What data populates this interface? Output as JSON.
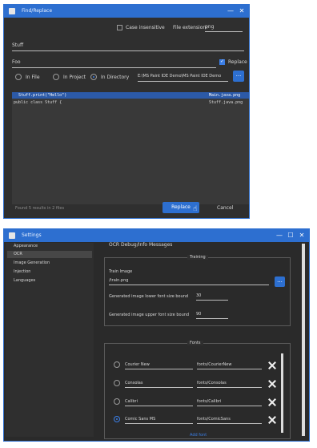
{
  "find_replace": {
    "title": "Find/Replace",
    "case_insensitive": "Case insensitive",
    "file_extension_label": "File extension:",
    "file_extension_value": "png",
    "find_value": "Stuff",
    "replace_value": "Foo",
    "replace_checkbox": "Replace",
    "scope_in_file": "In File",
    "scope_in_project": "In Project",
    "scope_in_directory": "In Directory",
    "directory_path": "E:\\MS Paint IDE Demo\\MS Paint IDE Demo",
    "browse_button": "...",
    "results": [
      {
        "code": "Stuff.print(\"Hello\")",
        "file": "Main.java.png",
        "selected": true
      },
      {
        "code": "public class Stuff {",
        "file": "Stuff.java.png",
        "selected": false
      }
    ],
    "status": "Found 5 results in 2 files",
    "replace_button": "Replace",
    "cancel_button": "Cancel"
  },
  "settings": {
    "title": "Settings",
    "sidebar": [
      "Appearance",
      "OCR",
      "Image Generation",
      "Injection",
      "Languages"
    ],
    "ocr_debug": "OCR Debug/Info Messages",
    "training_group": "Training",
    "train_image_label": "Train Image",
    "train_image_value": "/train.png",
    "lower_bound_label": "Generated image lower font size bound",
    "lower_bound_value": "30",
    "upper_bound_label": "Generated image upper font size bound",
    "upper_bound_value": "90",
    "fonts_group": "Fonts",
    "fonts": [
      {
        "name": "Courier New",
        "path": "fonts/CourierNew",
        "selected": false
      },
      {
        "name": "Consolas",
        "path": "fonts/Consolas",
        "selected": false
      },
      {
        "name": "Calibri",
        "path": "fonts/Calibri",
        "selected": false
      },
      {
        "name": "Comic Sans MS",
        "path": "fonts/ComicSans",
        "selected": true
      }
    ],
    "add_link": "Add font"
  }
}
